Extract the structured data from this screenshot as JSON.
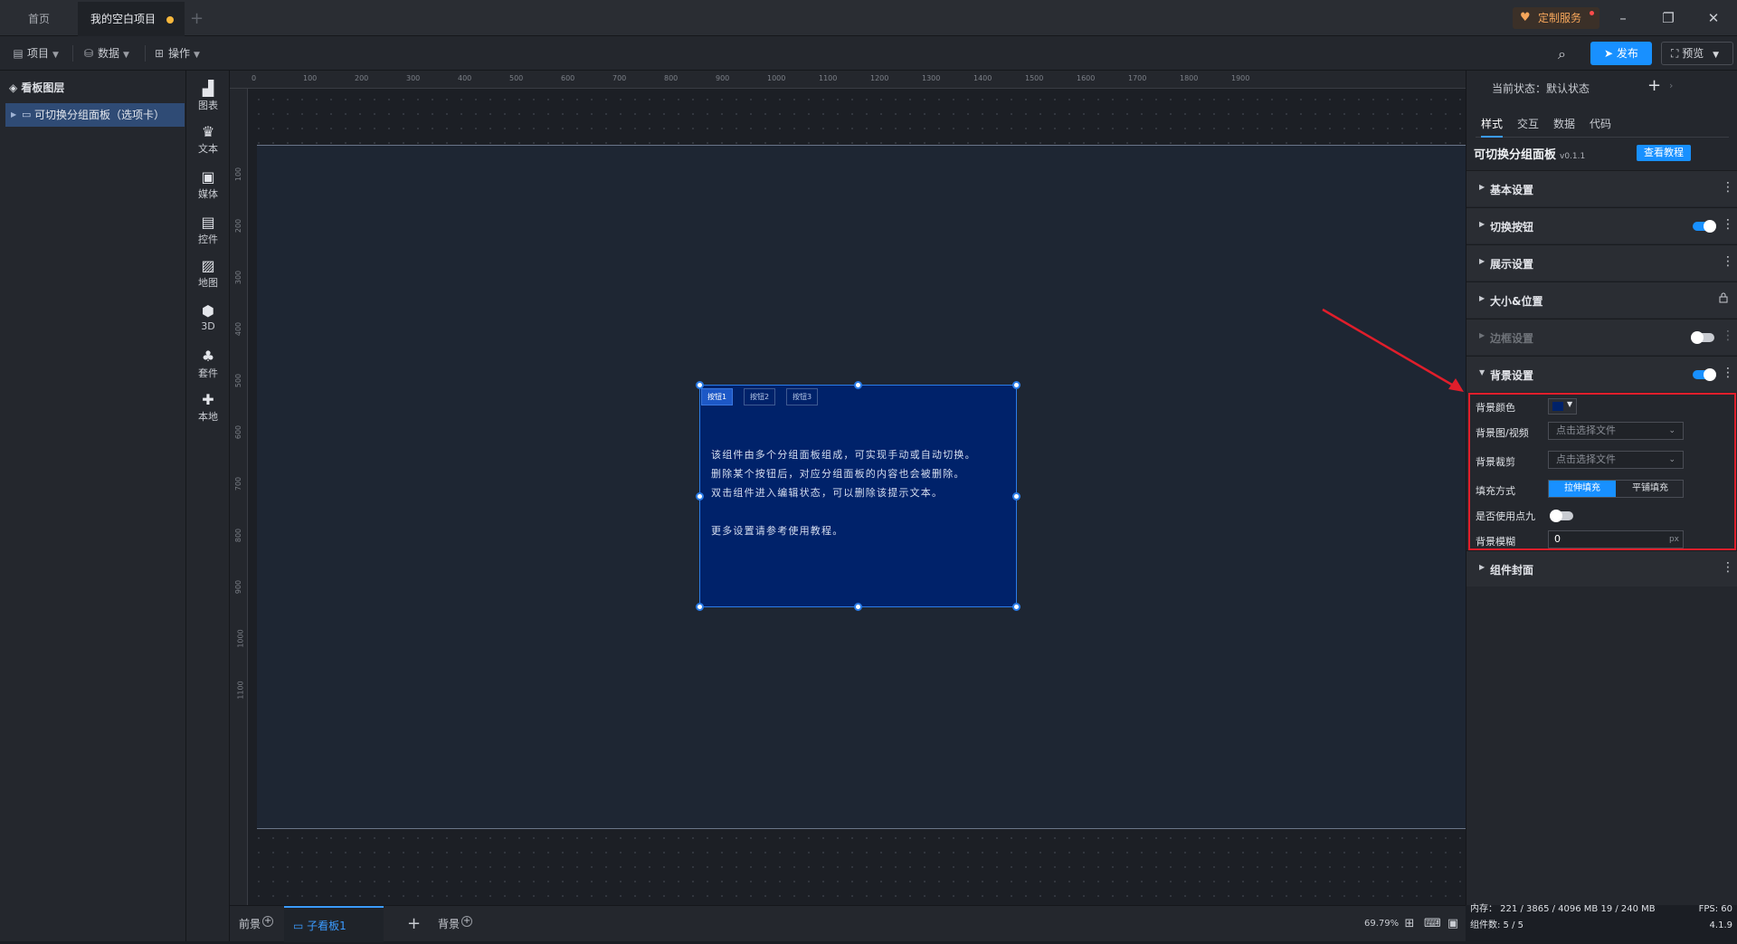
{
  "tabs": {
    "home": "首页",
    "project": "我的空白项目"
  },
  "custom_service": "定制服务",
  "menus": {
    "project": "项目",
    "data": "数据",
    "operate": "操作"
  },
  "toolbar": {
    "publish": "发布",
    "preview": "预览"
  },
  "layers": {
    "title": "看板图层",
    "item": "可切换分组面板（选项卡）"
  },
  "rail": [
    "图表",
    "文本",
    "媒体",
    "控件",
    "地图",
    "3D",
    "套件",
    "本地"
  ],
  "ruler_h": [
    "0",
    "100",
    "200",
    "300",
    "400",
    "500",
    "600",
    "700",
    "800",
    "900",
    "1000",
    "1100",
    "1200",
    "1300",
    "1400",
    "1500",
    "1600",
    "1700",
    "1800",
    "1900"
  ],
  "ruler_v": [
    "100",
    "200",
    "300",
    "400",
    "500",
    "600",
    "700",
    "800",
    "900",
    "1000",
    "1100"
  ],
  "component": {
    "buttons": [
      "按钮1",
      "按钮2",
      "按钮3"
    ],
    "lines": [
      "该组件由多个分组面板组成，可实现手动或自动切换。",
      "删除某个按钮后，对应分组面板的内容也会被删除。",
      "双击组件进入编辑状态，可以删除该提示文本。",
      "",
      "更多设置请参考使用教程。"
    ],
    "bg_color": "#00226a"
  },
  "bottom": {
    "front": "前景",
    "sub_board": "子看板1",
    "bg": "背景",
    "zoom": "69.79%"
  },
  "props": {
    "state_label": "当前状态：默认状态",
    "tabs": [
      "样式",
      "交互",
      "数据",
      "代码"
    ],
    "comp_name": "可切换分组面板",
    "version": "v0.1.1",
    "tutorial": "查看教程",
    "sections": {
      "basic": "基本设置",
      "switch_btn": "切换按钮",
      "display": "展示设置",
      "size_pos": "大小&位置",
      "border": "边框设置",
      "background": "背景设置",
      "cover": "组件封面"
    },
    "toggles": {
      "switch_btn": true,
      "border": false,
      "background": true,
      "use_nine": false
    },
    "bg_fields": {
      "color_label": "背景颜色",
      "image_label": "背景图/视频",
      "image_placeholder": "点击选择文件",
      "crop_label": "背景裁剪",
      "crop_placeholder": "点击选择文件",
      "fill_label": "填充方式",
      "fill_options": [
        "拉伸填充",
        "平铺填充"
      ],
      "fill_selected": "拉伸填充",
      "nine_label": "是否使用点九",
      "blur_label": "背景模糊",
      "blur_value": "0",
      "blur_unit": "px"
    }
  },
  "stats": {
    "memory": "内存： 221 / 3865 / 4096 MB  19 / 240 MB",
    "count": "组件数: 5 / 5",
    "fps": "FPS:  60",
    "version": "4.1.9"
  },
  "colors": {
    "accent": "#1890ff",
    "highlight": "#e01e2b"
  }
}
